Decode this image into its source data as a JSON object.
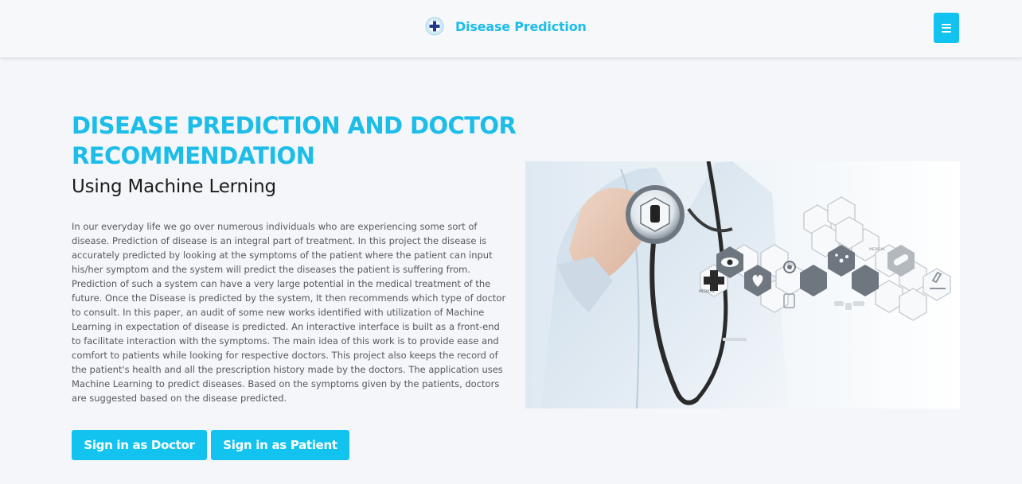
{
  "header": {
    "brand_text": "Disease Prediction",
    "logo_icon": "medical-cross-icon",
    "menu_icon": "hamburger-menu-icon"
  },
  "hero": {
    "title": "DISEASE PREDICTION AND DOCTOR RECOMMENDATION",
    "subtitle": "Using Machine Lerning",
    "description": "In our everyday life we go over numerous individuals who are experiencing some sort of disease. Prediction of disease is an integral part of treatment. In this project the disease is accurately predicted by looking at the symptoms of the patient where the patient can input his/her symptom and the system will predict the diseases the patient is suffering from. Prediction of such a system can have a very large potential in the medical treatment of the future. Once the Disease is predicted by the system, It then recommends which type of doctor to consult. In this paper, an audit of some new works identified with utilization of Machine Learning in expectation of disease is predicted. An interactive interface is built as a front-end to facilitate interaction with the symptoms. The main idea of this work is to provide ease and comfort to patients while looking for respective doctors. This project also keeps the record of the patient's health and all the prescription history made by the doctors. The application uses Machine Learning to predict diseases. Based on the symptoms given by the patients, doctors are suggested based on the disease predicted.",
    "buttons": {
      "doctor": "Sign in as Doctor",
      "patient": "Sign in as Patient"
    },
    "image_labels": {
      "hex_left": "MEDICAL",
      "hex_right": "MEDICAL"
    }
  },
  "colors": {
    "accent": "#13c3ef",
    "title": "#1cbde9",
    "background": "#f4f6f9",
    "text": "#55595e"
  }
}
